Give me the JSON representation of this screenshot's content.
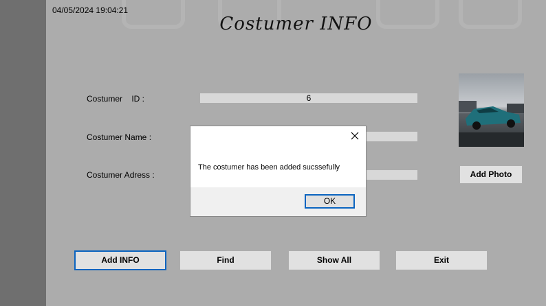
{
  "datetime": "04/05/2024 19:04:21",
  "title": "Costumer INFO",
  "form": {
    "id_label": "Costumer    ID :",
    "id_value": "6",
    "name_label": "Costumer Name :",
    "name_value": "",
    "address_label": "Costumer Adress :",
    "address_value": ""
  },
  "photo": {
    "icon": "car-photo"
  },
  "buttons": {
    "add_photo": "Add Photo",
    "add_info": "Add INFO",
    "find": "Find",
    "show_all": "Show All",
    "exit": "Exit"
  },
  "dialog": {
    "message": "The costumer has been added sucssefully",
    "ok": "OK",
    "close_icon": "close-icon"
  },
  "colors": {
    "form_bg": "#acacac",
    "accent_border": "#0a64c0"
  }
}
